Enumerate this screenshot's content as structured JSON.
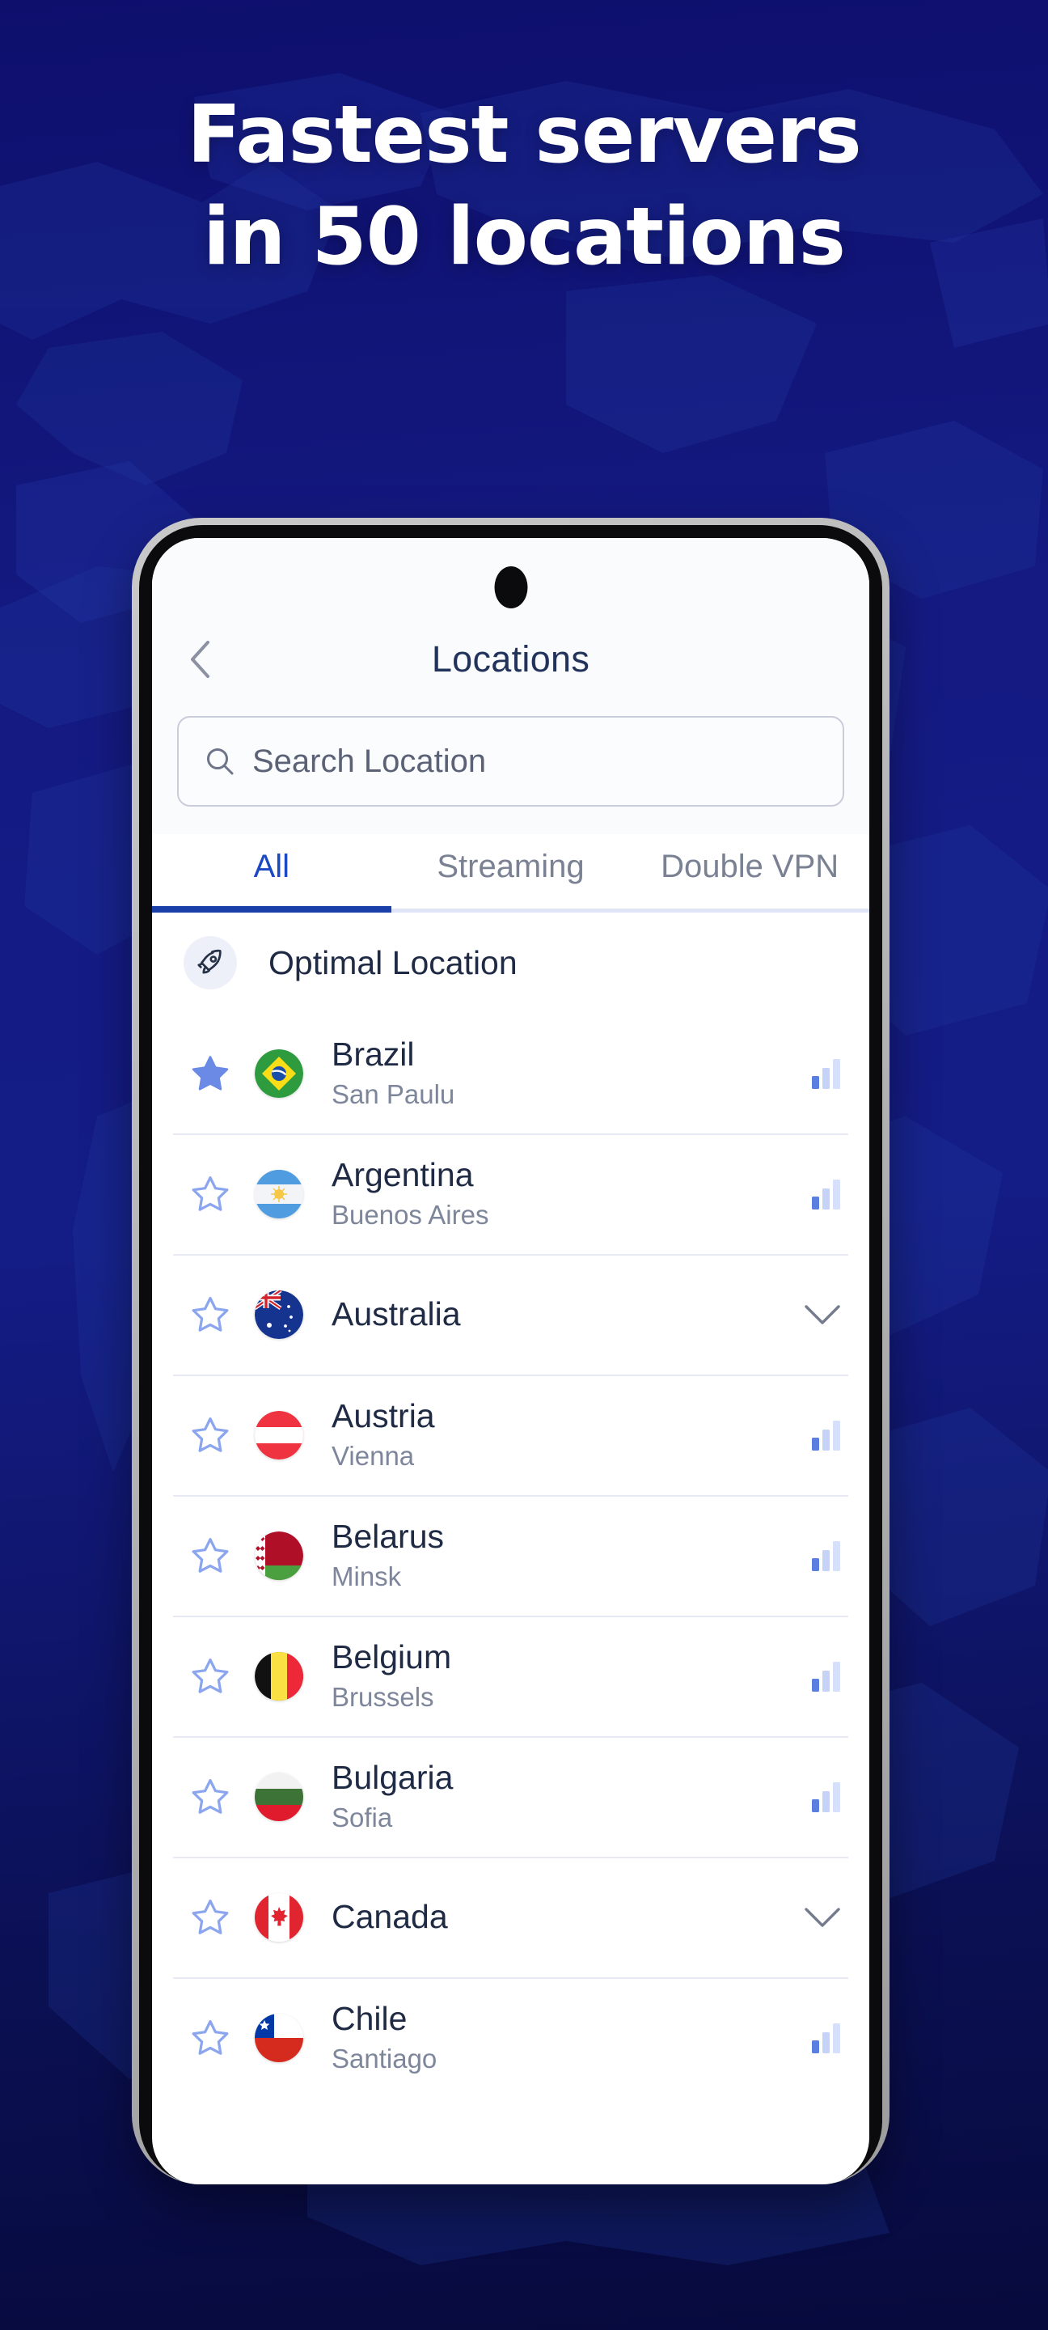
{
  "promo": {
    "headline_line1": "Fastest servers",
    "headline_line2": "in 50 locations",
    "background_color": "#101272",
    "accent_color": "#1b48c4"
  },
  "phone": {
    "screen": {
      "header": {
        "back_icon": "chevron-left-icon",
        "title": "Locations"
      },
      "search": {
        "icon": "search-icon",
        "placeholder": "Search Location",
        "value": ""
      },
      "tabs": [
        {
          "label": "All",
          "active": true
        },
        {
          "label": "Streaming",
          "active": false
        },
        {
          "label": "Double VPN",
          "active": false
        }
      ],
      "optimal": {
        "icon": "rocket-icon",
        "label": "Optimal Location"
      },
      "locations": [
        {
          "country": "Brazil",
          "city": "San Paulu",
          "flag": "br",
          "favorite": true,
          "right": "signal-bars-icon"
        },
        {
          "country": "Argentina",
          "city": "Buenos Aires",
          "flag": "ar",
          "favorite": false,
          "right": "signal-bars-icon"
        },
        {
          "country": "Australia",
          "city": "",
          "flag": "au",
          "favorite": false,
          "right": "chevron-down-icon"
        },
        {
          "country": "Austria",
          "city": "Vienna",
          "flag": "at",
          "favorite": false,
          "right": "signal-bars-icon"
        },
        {
          "country": "Belarus",
          "city": "Minsk",
          "flag": "by",
          "favorite": false,
          "right": "signal-bars-icon"
        },
        {
          "country": "Belgium",
          "city": "Brussels",
          "flag": "be",
          "favorite": false,
          "right": "signal-bars-icon"
        },
        {
          "country": "Bulgaria",
          "city": "Sofia",
          "flag": "bg",
          "favorite": false,
          "right": "signal-bars-icon"
        },
        {
          "country": "Canada",
          "city": "",
          "flag": "ca",
          "favorite": false,
          "right": "chevron-down-icon"
        },
        {
          "country": "Chile",
          "city": "Santiago",
          "flag": "cl",
          "favorite": false,
          "right": "signal-bars-icon"
        }
      ]
    }
  }
}
